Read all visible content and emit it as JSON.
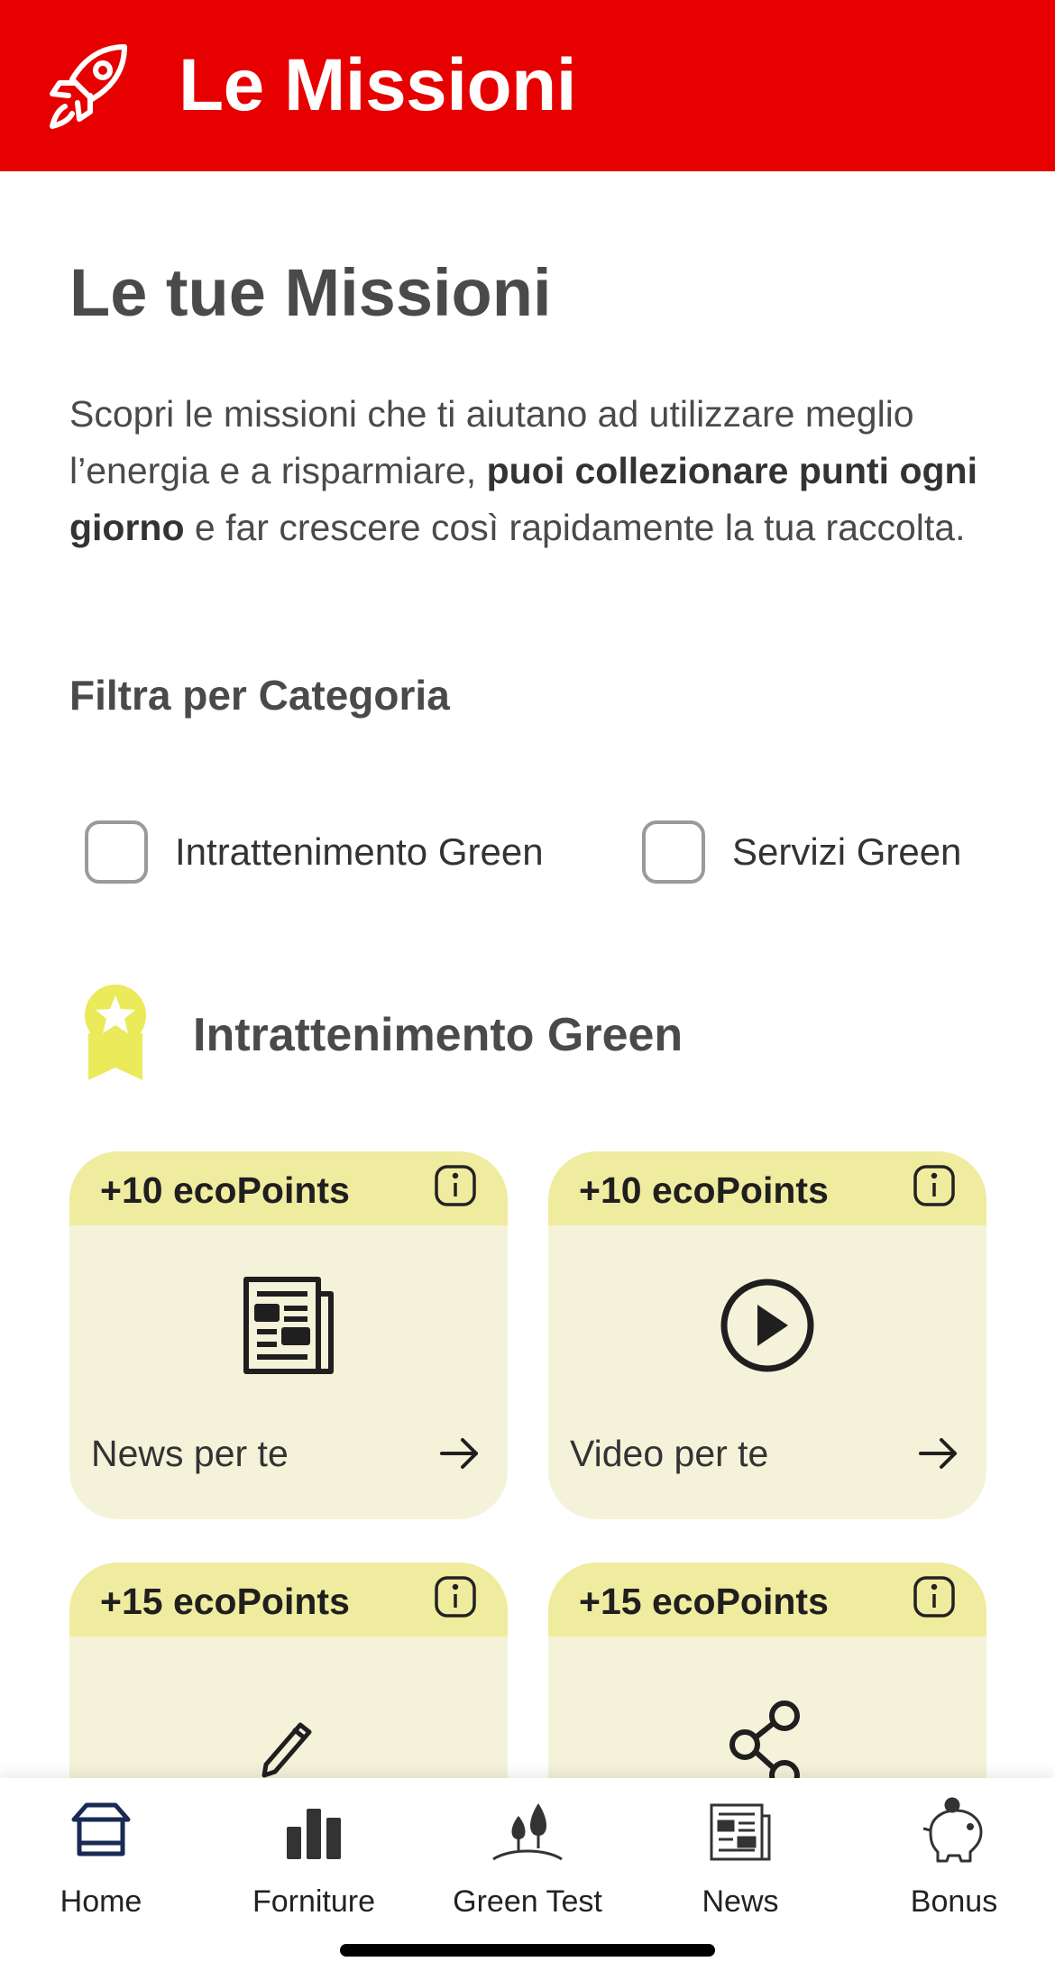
{
  "header": {
    "title": "Le Missioni",
    "icon": "rocket-icon",
    "background": "#e60000"
  },
  "page": {
    "title": "Le tue Missioni",
    "intro": {
      "part1": "Scopri le missioni che ti aiutano ad utilizzare meglio l’energia e a risparmiare, ",
      "bold": "puoi collezionare punti ogni giorno",
      "part2": " e far crescere così rapidamente la tua raccolta."
    },
    "filter_title": "Filtra per Categoria"
  },
  "filters": [
    {
      "label": "Intrattenimento Green",
      "checked": false
    },
    {
      "label": "Servizi Green",
      "checked": false
    }
  ],
  "section": {
    "title": "Intrattenimento Green",
    "icon": "award-badge-icon",
    "accent": "#f0ec9f"
  },
  "cards": [
    {
      "points": "+10 ecoPoints",
      "name": "News per te",
      "icon": "newspaper-icon"
    },
    {
      "points": "+10 ecoPoints",
      "name": "Video per te",
      "icon": "play-icon"
    },
    {
      "points": "+15 ecoPoints",
      "name": "",
      "icon": "pencil-icon"
    },
    {
      "points": "+15 ecoPoints",
      "name": "",
      "icon": "share-icon"
    }
  ],
  "tabbar": [
    {
      "label": "Home",
      "icon": "home-icon"
    },
    {
      "label": "Forniture",
      "icon": "bar-chart-icon"
    },
    {
      "label": "Green Test",
      "icon": "trees-icon"
    },
    {
      "label": "News",
      "icon": "newspaper-icon"
    },
    {
      "label": "Bonus",
      "icon": "piggy-bank-icon"
    }
  ]
}
